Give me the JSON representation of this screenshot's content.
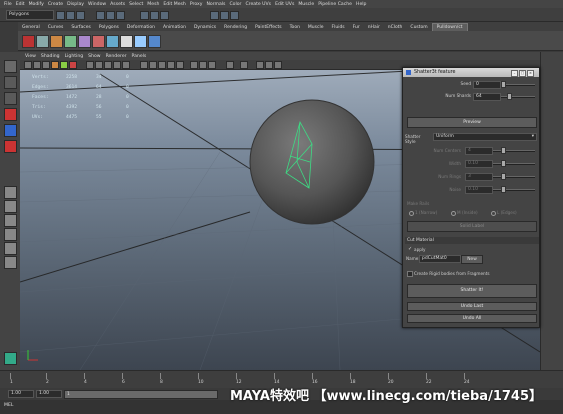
{
  "menubar": [
    "File",
    "Edit",
    "Modify",
    "Create",
    "Display",
    "Window",
    "Assets",
    "Select",
    "Mesh",
    "Edit Mesh",
    "Proxy",
    "Normals",
    "Color",
    "Create UVs",
    "Edit UVs",
    "Muscle",
    "Pipeline Cache",
    "Help"
  ],
  "status_line": {
    "mode": "Polygons"
  },
  "shelf_tabs": [
    "General",
    "Curves",
    "Surfaces",
    "Polygons",
    "Deformation",
    "Animation",
    "Dynamics",
    "Rendering",
    "PaintEffects",
    "Toon",
    "Muscle",
    "Fluids",
    "Fur",
    "nHair",
    "nCloth",
    "Custom",
    "Pulldown/ct"
  ],
  "shelf_active": "Pulldown/ct",
  "viewport": {
    "menus": [
      "View",
      "Shading",
      "Lighting",
      "Show",
      "Renderer",
      "Panels"
    ],
    "hud": [
      {
        "label": "Verts:",
        "v1": "2258",
        "v2": "34",
        "v3": "0"
      },
      {
        "label": "Edges:",
        "v1": "3614",
        "v2": "64",
        "v3": "0"
      },
      {
        "label": "Faces:",
        "v1": "1472",
        "v2": "28",
        "v3": "0"
      },
      {
        "label": "Tris:",
        "v1": "4392",
        "v2": "56",
        "v3": "0"
      },
      {
        "label": "UVs:",
        "v1": "4475",
        "v2": "55",
        "v3": "0"
      }
    ]
  },
  "shatter_window": {
    "title": "Shatter3t feature",
    "seed_label": "Seed",
    "seed_value": "0",
    "num_shards_label": "Num Shards",
    "num_shards_value": "64",
    "preview_label": "Preview",
    "shatter_style_label": "Shatter Style",
    "shatter_style_value": "Uniform",
    "num_centers_label": "Num Centers",
    "num_centers_value": "4",
    "width_label": "Width",
    "width_value": "0.10",
    "num_rings_label": "Num Rings",
    "num_rings_value": "3",
    "noise_label": "Noise",
    "noise_value": "0.10",
    "make_rails_label": "Make Rails",
    "rail_options": [
      "1 (Narrow)",
      "M (Inside)",
      "L (Edges)"
    ],
    "solid_label": "Solid Label",
    "cut_material_label": "Cut Material",
    "apply_label": "apply",
    "name_label": "Name:",
    "name_value": "pdCutMat0",
    "new_button": "New",
    "create_rigid_label": "Create Rigid bodies from Fragments",
    "shatter_button": "Shatter It!",
    "undo_last_button": "Undo Last",
    "undo_all_button": "Undo All"
  },
  "timeline": {
    "ticks": [
      "1",
      "2",
      "4",
      "6",
      "8",
      "10",
      "12",
      "14",
      "16",
      "18",
      "20",
      "22",
      "24"
    ],
    "range_start": "1.00",
    "range_field": "1.00",
    "range_frame": "1"
  },
  "help_line": "MEL",
  "watermark": "MAYA特效吧 【www.linecg.com/tieba/1745】",
  "colors": {
    "sphere": "#5a5a5a",
    "wireframe_highlight": "#3ddc84",
    "viewport_top": "#a7b3c1"
  }
}
